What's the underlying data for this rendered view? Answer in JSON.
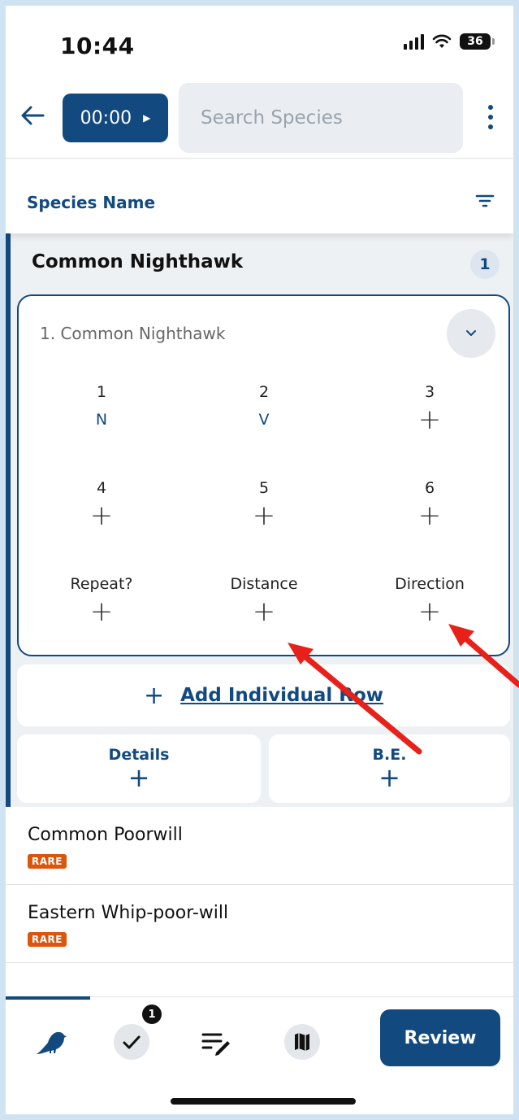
{
  "status_bar": {
    "time": "10:44",
    "battery": "36"
  },
  "header": {
    "timer": "00:00",
    "search_placeholder": "Search Species"
  },
  "sort": {
    "label": "Species Name"
  },
  "expanded_species": {
    "name": "Common Nighthawk",
    "count": "1",
    "card": {
      "title": "1. Common Nighthawk",
      "cells": [
        {
          "label": "1",
          "value": "N"
        },
        {
          "label": "2",
          "value": "V"
        },
        {
          "label": "3",
          "value": "+"
        },
        {
          "label": "4",
          "value": "+"
        },
        {
          "label": "5",
          "value": "+"
        },
        {
          "label": "6",
          "value": "+"
        },
        {
          "label": "Repeat?",
          "value": "+"
        },
        {
          "label": "Distance",
          "value": "+"
        },
        {
          "label": "Direction",
          "value": "+"
        }
      ]
    },
    "add_row": {
      "plus": "+",
      "label": "Add Individual Row"
    },
    "details": {
      "label": "Details",
      "plus": "+"
    },
    "be": {
      "label": "B.E.",
      "plus": "+"
    }
  },
  "species_list": [
    {
      "name": "Common Poorwill",
      "badge": "RARE"
    },
    {
      "name": "Eastern Whip-poor-will",
      "badge": "RARE"
    }
  ],
  "bottom_nav": {
    "checklist_badge": "1",
    "review_label": "Review",
    "icons": [
      "bird-icon",
      "check-icon",
      "notes-edit-icon",
      "map-icon"
    ]
  },
  "colors": {
    "primary": "#124a80",
    "rare": "#d9560b",
    "arrow": "#e8201a"
  }
}
